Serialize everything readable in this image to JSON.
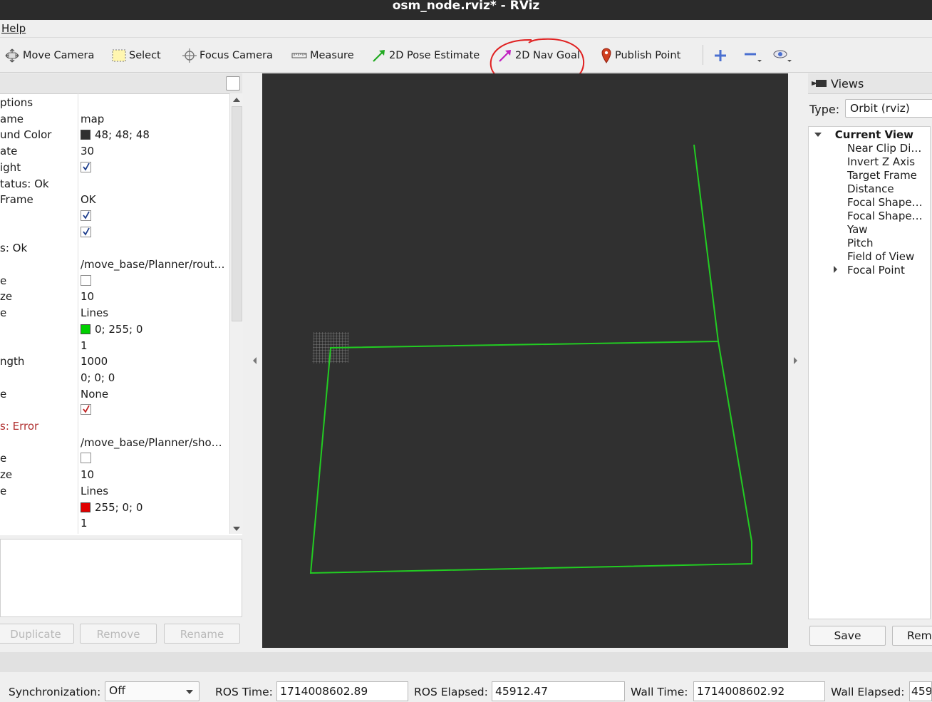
{
  "window": {
    "title": "osm_node.rviz* - RViz"
  },
  "menu": {
    "help": "Help"
  },
  "toolbar": {
    "move_camera": "Move Camera",
    "select": "Select",
    "focus_camera": "Focus Camera",
    "measure": "Measure",
    "pose_estimate": "2D Pose Estimate",
    "nav_goal": "2D Nav Goal",
    "publish_point": "Publish Point"
  },
  "displays": {
    "rows": [
      {
        "key": "ptions",
        "value": ""
      },
      {
        "key": "ame",
        "value": "map"
      },
      {
        "key": "und Color",
        "value": "48; 48; 48",
        "swatch": "#303030"
      },
      {
        "key": "ate",
        "value": "30"
      },
      {
        "key": "ight",
        "checkbox": true,
        "checked": true,
        "tick": "#1d3d8c"
      },
      {
        "key": "tatus: Ok",
        "value": ""
      },
      {
        "key": " Frame",
        "value": "OK"
      },
      {
        "key": "",
        "checkbox": true,
        "checked": true,
        "tick": "#1d3d8c"
      },
      {
        "key": "",
        "checkbox": true,
        "checked": true,
        "tick": "#1d3d8c"
      },
      {
        "key": "s: Ok",
        "value": ""
      },
      {
        "key": "",
        "value": "/move_base/Planner/rout…"
      },
      {
        "key": "e",
        "checkbox": true,
        "checked": false
      },
      {
        "key": "ze",
        "value": "10"
      },
      {
        "key": "e",
        "value": "Lines"
      },
      {
        "key": "",
        "value": "0; 255; 0",
        "swatch": "#00d000"
      },
      {
        "key": "",
        "value": "1"
      },
      {
        "key": "ngth",
        "value": "1000"
      },
      {
        "key": "",
        "value": "0; 0; 0"
      },
      {
        "key": "e",
        "value": "None"
      },
      {
        "key": "",
        "checkbox": true,
        "checked": true,
        "tick": "#c02020"
      },
      {
        "key": "s: Error",
        "value": "",
        "error": true
      },
      {
        "key": "",
        "value": "/move_base/Planner/sho…"
      },
      {
        "key": "e",
        "checkbox": true,
        "checked": false
      },
      {
        "key": "ze",
        "value": "10"
      },
      {
        "key": "e",
        "value": "Lines"
      },
      {
        "key": "",
        "value": "255; 0; 0",
        "swatch": "#e00000"
      },
      {
        "key": "",
        "value": "1"
      }
    ],
    "buttons": {
      "duplicate": "Duplicate",
      "remove": "Remove",
      "rename": "Rename"
    }
  },
  "views": {
    "header": "Views",
    "type_label": "Type:",
    "type_value": "Orbit (rviz)",
    "current_view": "Current View",
    "items": [
      "Near Clip Di…",
      "Invert Z Axis",
      "Target Frame",
      "Distance",
      "Focal Shape…",
      "Focal Shape…",
      "Yaw",
      "Pitch",
      "Field of View",
      "Focal Point"
    ],
    "save": "Save",
    "remove": "Rem"
  },
  "status": {
    "sync_label": "Synchronization:",
    "sync_value": "Off",
    "ros_time_label": "ROS Time:",
    "ros_time": "1714008602.89",
    "ros_elapsed_label": "ROS Elapsed:",
    "ros_elapsed": "45912.47",
    "wall_time_label": "Wall Time:",
    "wall_time": "1714008602.92",
    "wall_elapsed_label": "Wall Elapsed:",
    "wall_elapsed": "459"
  },
  "colors": {
    "path": "#22cc22",
    "viewport_bg": "#303030",
    "annotation": "#e02020"
  }
}
